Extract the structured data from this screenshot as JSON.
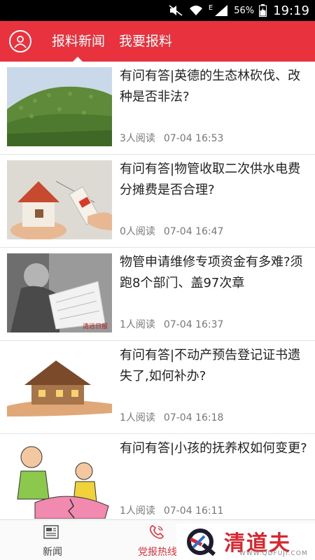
{
  "status_bar": {
    "battery_percent": "56%",
    "time": "19:19",
    "network_label": "E"
  },
  "header": {
    "tabs": [
      {
        "label": "报料新闻",
        "active": true
      },
      {
        "label": "我要报料",
        "active": false
      }
    ]
  },
  "news": [
    {
      "title": "有问有答|英德的生态林砍伐、改种是否非法?",
      "reads": "3人阅读",
      "time": "07-04 16:53",
      "image": "hillside-forest"
    },
    {
      "title": "有问有答|物管收取二次供水电费分摊费是否合理?",
      "reads": "0人阅读",
      "time": "07-04 16:47",
      "image": "house-in-hands-with-tag"
    },
    {
      "title": "物管申请维修专项资金有多难?须跑8个部门、盖97次章",
      "reads": "1人阅读",
      "time": "07-04 16:37",
      "image": "stamping-documents",
      "image_caption": "清远日报"
    },
    {
      "title": "有问有答|不动产预告登记证书遗失了,如何补办?",
      "reads": "1人阅读",
      "time": "07-04 16:18",
      "image": "house-on-hand"
    },
    {
      "title": "有问有答|小孩的抚养权如何变更?",
      "reads": "1人阅读",
      "time": "07-04 16:11",
      "image": "custody-cartoon"
    }
  ],
  "bottom_nav": [
    {
      "label": "新闻",
      "icon": "newspaper-icon",
      "active": false
    },
    {
      "label": "党报热线",
      "icon": "phone-icon",
      "active": true
    }
  ],
  "watermark": {
    "brand": "清道夫",
    "url": "WWW.QDFUJI.COM"
  },
  "colors": {
    "brand_red": "#e8333e",
    "status_bar": "#000000"
  }
}
